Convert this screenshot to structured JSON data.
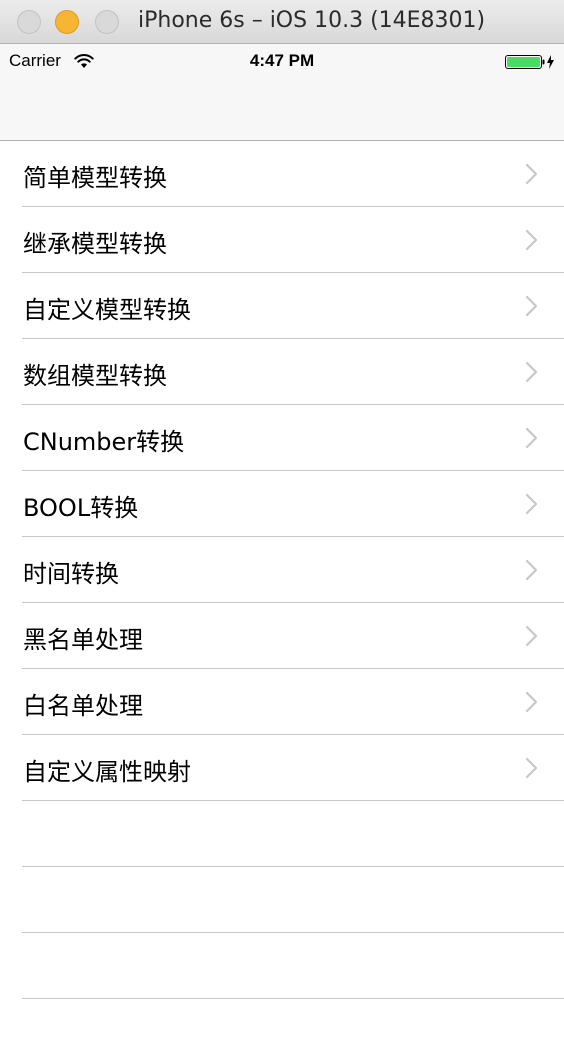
{
  "window": {
    "title": "iPhone 6s – iOS 10.3 (14E8301)"
  },
  "status_bar": {
    "carrier": "Carrier",
    "time": "4:47 PM",
    "battery_color": "#4cd964"
  },
  "table": {
    "rows": [
      {
        "label": "简单模型转换"
      },
      {
        "label": "继承模型转换"
      },
      {
        "label": "自定义模型转换"
      },
      {
        "label": "数组模型转换"
      },
      {
        "label": "CNumber转换"
      },
      {
        "label": "BOOL转换"
      },
      {
        "label": "时间转换"
      },
      {
        "label": "黑名单处理"
      },
      {
        "label": "白名单处理"
      },
      {
        "label": "自定义属性映射"
      }
    ]
  }
}
